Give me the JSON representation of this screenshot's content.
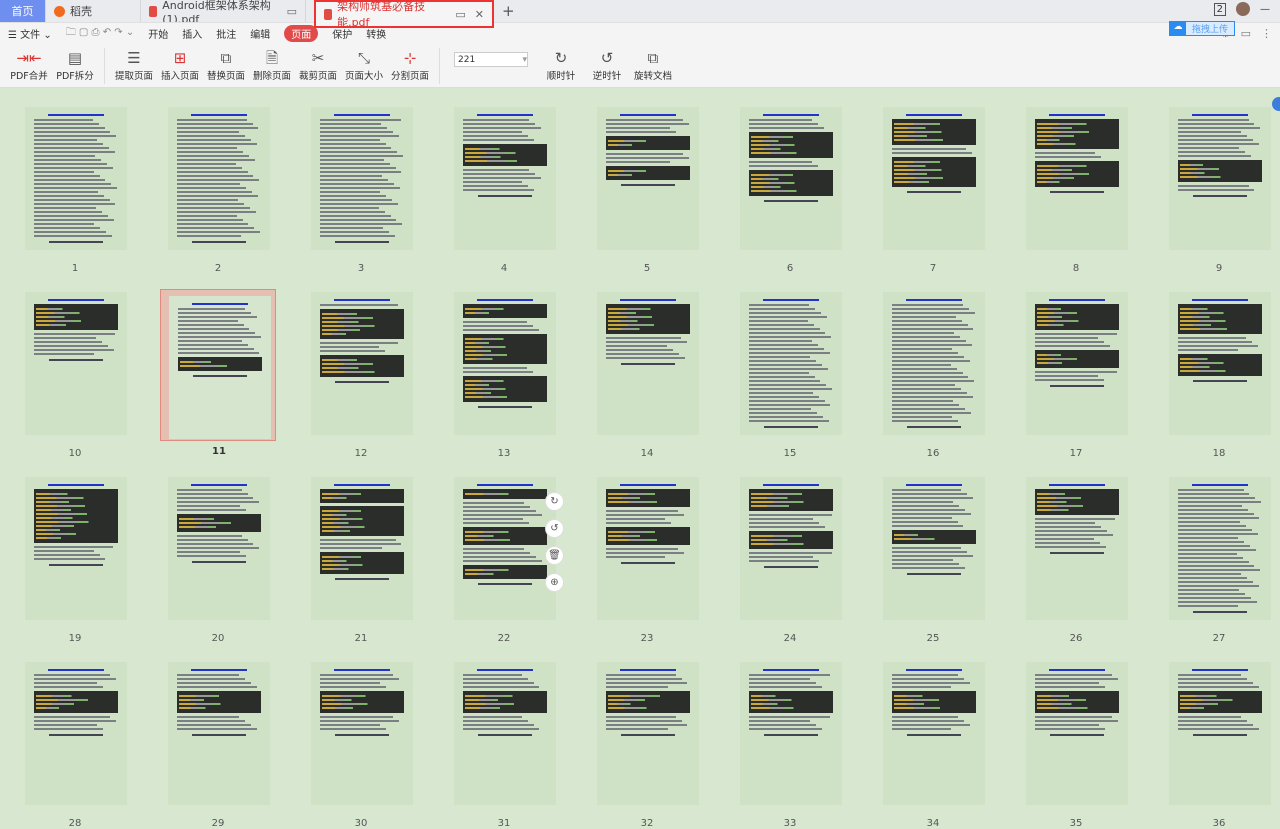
{
  "tabs": [
    {
      "label": "首页",
      "type": "home"
    },
    {
      "label": "稻壳",
      "type": "app"
    },
    {
      "label": "Android框架体系架构(1).pdf",
      "type": "file"
    },
    {
      "label": "架构师筑基必备技能.pdf",
      "type": "file",
      "active": true
    }
  ],
  "window": {
    "badge": "2"
  },
  "menu": {
    "file": "文件",
    "items": [
      "开始",
      "插入",
      "批注",
      "编辑",
      "页面",
      "保护",
      "转换"
    ],
    "selected": "页面"
  },
  "upload": {
    "label": "拖拽上传"
  },
  "toolbar": {
    "buttons": [
      "PDF合并",
      "PDF拆分",
      "提取页面",
      "插入页面",
      "替换页面",
      "删除页面",
      "裁剪页面",
      "页面大小",
      "分割页面"
    ],
    "zoom_value": "221",
    "rotate": [
      "顺时针",
      "逆时针",
      "旋转文档"
    ]
  },
  "pages": {
    "selected": 11,
    "numbers": [
      1,
      2,
      3,
      4,
      5,
      6,
      7,
      8,
      9,
      10,
      11,
      12,
      13,
      14,
      15,
      16,
      17,
      18,
      19,
      20,
      21,
      22,
      23,
      24,
      25,
      26,
      27,
      28,
      29,
      30,
      31,
      32,
      33,
      34,
      35,
      36
    ]
  },
  "hover_tools": [
    "rotate-clockwise",
    "rotate-counterclockwise",
    "delete",
    "insert"
  ],
  "colors": {
    "accent": "#e24a4a",
    "eye_bg": "#d8e8d0"
  }
}
